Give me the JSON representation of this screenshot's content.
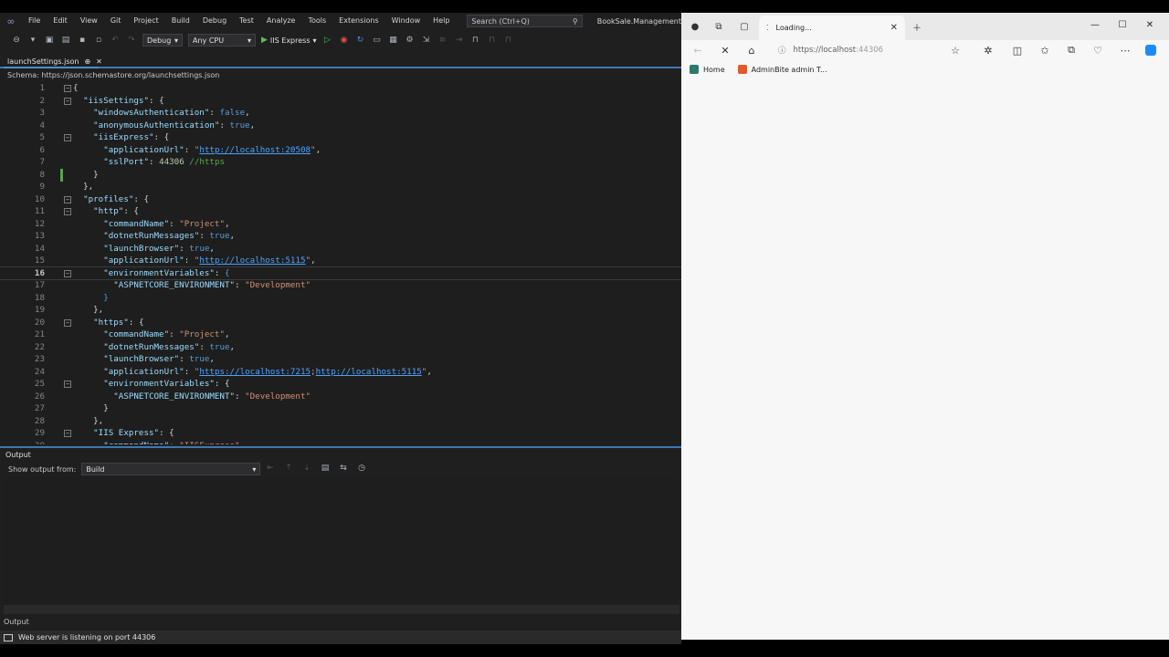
{
  "vs": {
    "menu": [
      "File",
      "Edit",
      "View",
      "Git",
      "Project",
      "Build",
      "Debug",
      "Test",
      "Analyze",
      "Tools",
      "Extensions",
      "Window",
      "Help"
    ],
    "search_placeholder": "Search (Ctrl+Q)",
    "solution_name": "BookSale.Management",
    "toolbar": {
      "config": "Debug",
      "platform": "Any CPU",
      "run_target": "IIS Express"
    },
    "tab": {
      "title": "launchSettings.json",
      "pin": "⊕",
      "close": "✕"
    },
    "schema": "Schema: https://json.schemastore.org/launchsettings.json",
    "current_line": 16,
    "output": {
      "title": "Output",
      "show_from_label": "Show output from:",
      "show_from_value": "Build",
      "bottom_tab": "Output"
    },
    "status_text": "Web server is listening on port 44306"
  },
  "code_lines": [
    [
      [
        "p",
        "{"
      ]
    ],
    [
      [
        "p",
        "  "
      ],
      [
        "k",
        "\"iisSettings\""
      ],
      [
        "p",
        ": {"
      ]
    ],
    [
      [
        "p",
        "    "
      ],
      [
        "k",
        "\"windowsAuthentication\""
      ],
      [
        "p",
        ": "
      ],
      [
        "b",
        "false"
      ],
      [
        "p",
        ","
      ]
    ],
    [
      [
        "p",
        "    "
      ],
      [
        "k",
        "\"anonymousAuthentication\""
      ],
      [
        "p",
        ": "
      ],
      [
        "b",
        "true"
      ],
      [
        "p",
        ","
      ]
    ],
    [
      [
        "p",
        "    "
      ],
      [
        "k",
        "\"iisExpress\""
      ],
      [
        "p",
        ": {"
      ]
    ],
    [
      [
        "p",
        "      "
      ],
      [
        "k",
        "\"applicationUrl\""
      ],
      [
        "p",
        ": "
      ],
      [
        "s",
        "\""
      ],
      [
        "u",
        "http://localhost:20508"
      ],
      [
        "s",
        "\""
      ],
      [
        "p",
        ","
      ]
    ],
    [
      [
        "p",
        "      "
      ],
      [
        "k",
        "\"sslPort\""
      ],
      [
        "p",
        ": "
      ],
      [
        "n",
        "44306"
      ],
      [
        "p",
        " "
      ],
      [
        "c",
        "//https"
      ]
    ],
    [
      [
        "p",
        "    }"
      ]
    ],
    [
      [
        "p",
        "  },"
      ]
    ],
    [
      [
        "p",
        "  "
      ],
      [
        "k",
        "\"profiles\""
      ],
      [
        "p",
        ": {"
      ]
    ],
    [
      [
        "p",
        "    "
      ],
      [
        "k",
        "\"http\""
      ],
      [
        "p",
        ": {"
      ]
    ],
    [
      [
        "p",
        "      "
      ],
      [
        "k",
        "\"commandName\""
      ],
      [
        "p",
        ": "
      ],
      [
        "s",
        "\"Project\""
      ],
      [
        "p",
        ","
      ]
    ],
    [
      [
        "p",
        "      "
      ],
      [
        "k",
        "\"dotnetRunMessages\""
      ],
      [
        "p",
        ": "
      ],
      [
        "b",
        "true"
      ],
      [
        "p",
        ","
      ]
    ],
    [
      [
        "p",
        "      "
      ],
      [
        "k",
        "\"launchBrowser\""
      ],
      [
        "p",
        ": "
      ],
      [
        "b",
        "true"
      ],
      [
        "p",
        ","
      ]
    ],
    [
      [
        "p",
        "      "
      ],
      [
        "k",
        "\"applicationUrl\""
      ],
      [
        "p",
        ": "
      ],
      [
        "s",
        "\""
      ],
      [
        "u",
        "http://localhost:5115"
      ],
      [
        "s",
        "\""
      ],
      [
        "p",
        ","
      ]
    ],
    [
      [
        "p",
        "      "
      ],
      [
        "k",
        "\"environmentVariables\""
      ],
      [
        "p",
        ": "
      ],
      [
        "b",
        "{"
      ]
    ],
    [
      [
        "p",
        "        "
      ],
      [
        "k",
        "\"ASPNETCORE_ENVIRONMENT\""
      ],
      [
        "p",
        ": "
      ],
      [
        "s",
        "\"Development\""
      ]
    ],
    [
      [
        "p",
        "      "
      ],
      [
        "b",
        "}"
      ]
    ],
    [
      [
        "p",
        "    },"
      ]
    ],
    [
      [
        "p",
        "    "
      ],
      [
        "k",
        "\"https\""
      ],
      [
        "p",
        ": {"
      ]
    ],
    [
      [
        "p",
        "      "
      ],
      [
        "k",
        "\"commandName\""
      ],
      [
        "p",
        ": "
      ],
      [
        "s",
        "\"Project\""
      ],
      [
        "p",
        ","
      ]
    ],
    [
      [
        "p",
        "      "
      ],
      [
        "k",
        "\"dotnetRunMessages\""
      ],
      [
        "p",
        ": "
      ],
      [
        "b",
        "true"
      ],
      [
        "p",
        ","
      ]
    ],
    [
      [
        "p",
        "      "
      ],
      [
        "k",
        "\"launchBrowser\""
      ],
      [
        "p",
        ": "
      ],
      [
        "b",
        "true"
      ],
      [
        "p",
        ","
      ]
    ],
    [
      [
        "p",
        "      "
      ],
      [
        "k",
        "\"applicationUrl\""
      ],
      [
        "p",
        ": "
      ],
      [
        "s",
        "\""
      ],
      [
        "u",
        "https://localhost:7215"
      ],
      [
        "s",
        ";"
      ],
      [
        "u",
        "http://localhost:5115"
      ],
      [
        "s",
        "\""
      ],
      [
        "p",
        ","
      ]
    ],
    [
      [
        "p",
        "      "
      ],
      [
        "k",
        "\"environmentVariables\""
      ],
      [
        "p",
        ": {"
      ]
    ],
    [
      [
        "p",
        "        "
      ],
      [
        "k",
        "\"ASPNETCORE_ENVIRONMENT\""
      ],
      [
        "p",
        ": "
      ],
      [
        "s",
        "\"Development\""
      ]
    ],
    [
      [
        "p",
        "      }"
      ]
    ],
    [
      [
        "p",
        "    },"
      ]
    ],
    [
      [
        "p",
        "    "
      ],
      [
        "k",
        "\"IIS Express\""
      ],
      [
        "p",
        ": {"
      ]
    ],
    [
      [
        "p",
        "      "
      ],
      [
        "k",
        "\"commandName\""
      ],
      [
        "p",
        ": "
      ],
      [
        "s",
        "\"IISExpress\""
      ],
      [
        "p",
        ","
      ]
    ]
  ],
  "fold_lines": [
    1,
    2,
    5,
    10,
    11,
    16,
    20,
    25,
    29
  ],
  "edge": {
    "tab_title": "Loading...",
    "url_host": "https://localhost",
    "url_port": ":44306",
    "bookmarks": [
      {
        "label": "Home",
        "color": "#2b7a6b"
      },
      {
        "label": "AdminBite admin T...",
        "color": "#e05a2b"
      }
    ],
    "copilot_color": "#1a8cff"
  }
}
